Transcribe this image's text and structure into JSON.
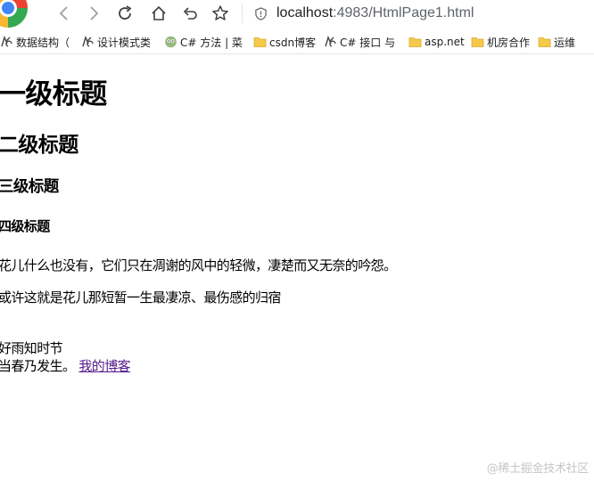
{
  "toolbar": {
    "url_host": "localhost",
    "url_rest": ":4983/HtmlPage1.html"
  },
  "bookmarks": [
    {
      "label": "数据结构（",
      "icon": "bookmark-logo-icon"
    },
    {
      "label": "设计模式类",
      "icon": "bookmark-logo-icon"
    },
    {
      "label": "C# 方法 | 菜",
      "icon": "runoob-icon"
    },
    {
      "label": "csdn博客",
      "icon": "folder-icon"
    },
    {
      "label": "C# 接口 与",
      "icon": "bookmark-logo-icon"
    },
    {
      "label": "asp.net",
      "icon": "folder-icon"
    },
    {
      "label": "机房合作",
      "icon": "folder-icon"
    },
    {
      "label": "运维",
      "icon": "folder-icon"
    }
  ],
  "page": {
    "h1": "一级标题",
    "h2": "二级标题",
    "h3": "三级标题",
    "h4": "四级标题",
    "p1": "花儿什么也没有，它们只在凋谢的风中的轻微，凄楚而又无奈的吟怨。",
    "p2": "或许这就是花儿那短暂一生最凄凉、最伤感的归宿",
    "poem_line1": "好雨知时节",
    "poem_line2": "当春乃发生。",
    "link": "我的博客"
  },
  "watermark": "@稀土掘金技术社区",
  "colors": {
    "link_visited": "#551a8b",
    "folder": "#f6c94a",
    "watermark": "#c6c6c6"
  }
}
